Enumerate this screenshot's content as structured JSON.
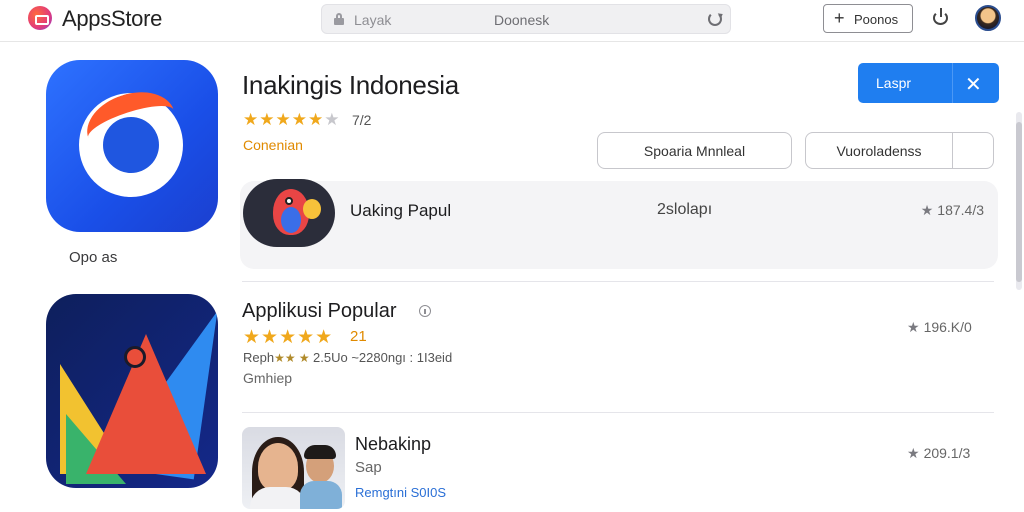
{
  "header": {
    "app_name": "AppsStore",
    "search": {
      "hint": "Layak",
      "value": "Doonesk"
    },
    "new_button": "Poonos"
  },
  "app": {
    "icon_caption": "Opo as",
    "title": "Inakingis Indonesia",
    "rating_count": "7/2",
    "category": "Conenian",
    "primary_button": "Laspr",
    "option_1": "Spoaria Mnnleal",
    "option_2": "Vuoroladenss"
  },
  "featured": {
    "title": "Uaking Papul",
    "middle": "2slolapı",
    "rating": "187.4/3"
  },
  "popular": {
    "title": "Applikusi Popular",
    "rating_count": "21",
    "rating": "196.K/0",
    "meta_prefix": "Reph",
    "meta": "2.5Uo ~2280ngı : 1I3eid",
    "sub": "Gmhiep"
  },
  "row3": {
    "title": "Nebakinp",
    "sub": "Sap",
    "link": "Remgtıni  S0I0S",
    "rating": "209.1/3"
  },
  "colors": {
    "accent": "#1f7ef0",
    "star": "#f0a81c",
    "category": "#e08a00",
    "link": "#2a6fd6"
  }
}
